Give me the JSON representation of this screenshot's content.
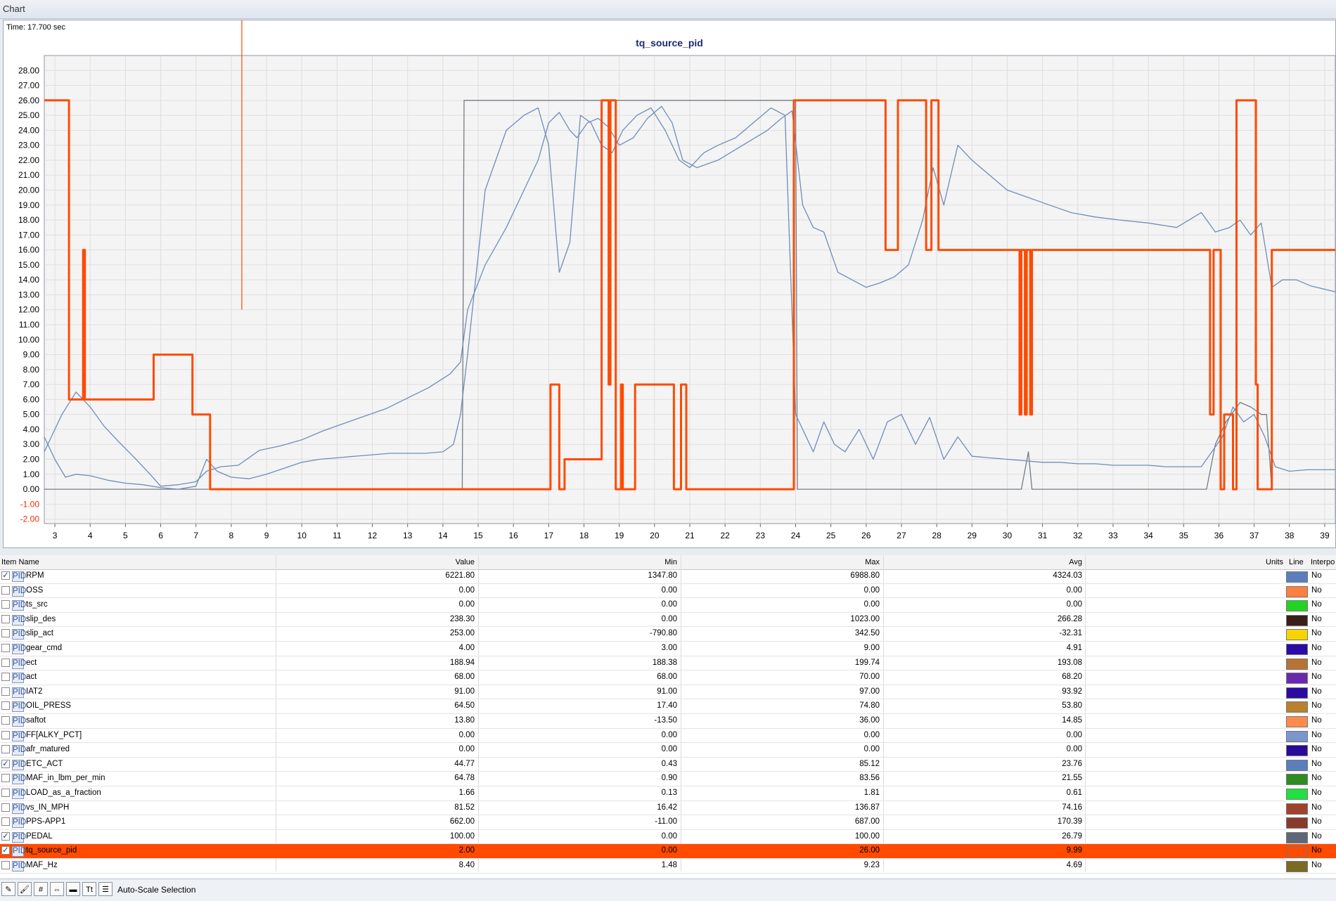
{
  "window": {
    "title": "Chart"
  },
  "chart": {
    "time_label": "Time: 17.700 sec",
    "title": "tq_source_pid"
  },
  "chart_data": {
    "type": "line",
    "title": "tq_source_pid",
    "ylim": [
      -2.3,
      29
    ],
    "xlim": [
      2.7,
      39.3
    ],
    "y_ticks": [
      "28.00",
      "27.00",
      "26.00",
      "25.00",
      "24.00",
      "23.00",
      "22.00",
      "21.00",
      "20.00",
      "19.00",
      "18.00",
      "17.00",
      "16.00",
      "15.00",
      "14.00",
      "13.00",
      "12.00",
      "11.00",
      "10.00",
      "9.00",
      "8.00",
      "7.00",
      "6.00",
      "5.00",
      "4.00",
      "3.00",
      "2.00",
      "1.00",
      "0.00",
      "-1.00",
      "-2.00"
    ],
    "x_ticks": [
      "3",
      "4",
      "5",
      "6",
      "7",
      "8",
      "9",
      "10",
      "11",
      "12",
      "13",
      "14",
      "15",
      "16",
      "17",
      "18",
      "19",
      "20",
      "21",
      "22",
      "23",
      "24",
      "25",
      "26",
      "27",
      "28",
      "29",
      "30",
      "31",
      "32",
      "33",
      "34",
      "35",
      "36",
      "37",
      "38",
      "39"
    ],
    "cursor_x": 8.3,
    "grid": true,
    "series": [
      {
        "color": "#ff4a00",
        "width": 3,
        "x": [
          2.7,
          3.4,
          3.4,
          3.8,
          3.8,
          3.85,
          3.85,
          5.8,
          5.8,
          6.9,
          6.9,
          7.4,
          7.4,
          17.05,
          17.05,
          17.3,
          17.3,
          17.45,
          17.45,
          18.5,
          18.5,
          18.7,
          18.7,
          18.75,
          18.75,
          18.9,
          18.9,
          19.05,
          19.05,
          19.1,
          19.1,
          19.45,
          19.45,
          20.55,
          20.55,
          20.75,
          20.75,
          20.9,
          20.9,
          23.95,
          23.95,
          26.55,
          26.55,
          26.9,
          26.9,
          27.7,
          27.7,
          27.85,
          27.85,
          28.05,
          28.05,
          28.55,
          28.55,
          30.35,
          30.35,
          30.4,
          30.4,
          30.5,
          30.5,
          30.55,
          30.55,
          30.65,
          30.65,
          30.7,
          30.7,
          35.75,
          35.75,
          35.85,
          35.85,
          36.05,
          36.05,
          36.15,
          36.15,
          36.4,
          36.4,
          36.5,
          36.5,
          37.05,
          37.05,
          37.1,
          37.1,
          37.5,
          37.5,
          37.6,
          37.6,
          39.3
        ],
        "y": [
          26,
          26,
          6,
          6,
          16,
          16,
          6,
          6,
          9,
          9,
          5,
          5,
          0,
          0,
          7,
          7,
          0,
          0,
          2,
          2,
          26,
          26,
          7,
          7,
          26,
          26,
          0,
          0,
          7,
          7,
          0,
          0,
          7,
          7,
          0,
          0,
          7,
          7,
          0,
          0,
          26,
          26,
          16,
          16,
          26,
          26,
          16,
          16,
          26,
          26,
          16,
          16,
          16,
          16,
          5,
          5,
          16,
          16,
          5,
          5,
          16,
          16,
          5,
          5,
          16,
          16,
          5,
          5,
          16,
          16,
          0,
          0,
          5,
          5,
          0,
          0,
          26,
          26,
          7,
          7,
          0,
          0,
          16,
          16,
          16,
          16
        ]
      },
      {
        "color": "#6f8db9",
        "width": 1.3,
        "x": [
          2.7,
          2.9,
          3.2,
          3.6,
          4.0,
          4.4,
          4.8,
          5.3,
          5.7,
          6.0,
          6.5,
          7.0,
          7.3,
          7.7,
          8.2,
          8.8,
          9.4,
          10.0,
          10.6,
          11.2,
          11.8,
          12.4,
          13.0,
          13.6,
          14.2,
          14.5,
          14.7,
          15.2,
          15.8,
          16.3,
          16.7,
          17.0,
          17.3,
          17.6,
          17.8,
          18.1,
          18.4,
          18.7,
          19.0,
          19.4,
          19.8,
          20.2,
          20.5,
          20.8,
          21.2,
          21.8,
          22.5,
          23.2,
          23.6,
          23.9,
          24.2,
          24.5,
          24.8,
          25.2,
          25.6,
          26.0,
          26.4,
          26.8,
          27.2,
          27.6,
          27.9,
          28.2,
          28.6,
          29.0,
          29.5,
          30.0,
          30.6,
          31.2,
          31.8,
          32.5,
          33.2,
          34.0,
          34.8,
          35.5,
          35.9,
          36.3,
          36.6,
          36.9,
          37.2,
          37.5,
          37.8,
          38.2,
          38.6,
          39.3
        ],
        "y": [
          2.5,
          3.5,
          5.0,
          6.5,
          5.5,
          4.2,
          3.2,
          2.0,
          1.0,
          0.2,
          0.3,
          0.5,
          1.2,
          1.5,
          1.6,
          2.6,
          2.9,
          3.3,
          3.9,
          4.4,
          4.9,
          5.4,
          6.1,
          6.8,
          7.7,
          8.5,
          12.0,
          15.0,
          17.5,
          20.0,
          22.0,
          24.5,
          25.2,
          24.0,
          23.5,
          24.5,
          24.8,
          24.2,
          23.0,
          23.5,
          24.8,
          25.6,
          24.5,
          22.0,
          21.5,
          22.0,
          23.0,
          24.0,
          24.8,
          25.3,
          19.0,
          17.5,
          17.2,
          14.5,
          14.0,
          13.5,
          13.8,
          14.2,
          15.0,
          18.0,
          21.5,
          19.0,
          23.0,
          22.0,
          21.0,
          20.0,
          19.5,
          19.0,
          18.5,
          18.2,
          18.0,
          17.8,
          17.5,
          18.5,
          17.2,
          17.5,
          18.0,
          17.0,
          17.8,
          13.5,
          14.0,
          14.0,
          13.6,
          13.2
        ]
      },
      {
        "color": "#6f8db9",
        "width": 1.3,
        "x": [
          2.7,
          3.0,
          3.3,
          3.6,
          4.0,
          4.5,
          5.0,
          5.5,
          6.0,
          6.5,
          7.0,
          7.3,
          7.6,
          8.0,
          8.5,
          9.0,
          9.5,
          10.0,
          10.5,
          11.0,
          11.5,
          12.0,
          12.5,
          13.0,
          13.5,
          14.0,
          14.3,
          14.5,
          14.7,
          15.2,
          15.8,
          16.3,
          16.7,
          17.0,
          17.3,
          17.6,
          17.9,
          18.2,
          18.5,
          18.8,
          19.1,
          19.5,
          19.9,
          20.3,
          20.7,
          21.0,
          21.4,
          21.8,
          22.3,
          22.8,
          23.3,
          23.7,
          24.0,
          24.2,
          24.5,
          24.8,
          25.1,
          25.4,
          25.8,
          26.2,
          26.6,
          27.0,
          27.4,
          27.8,
          28.2,
          28.6,
          29.0,
          29.5,
          30.0,
          30.5,
          31.0,
          31.5,
          32.0,
          32.5,
          33.0,
          33.5,
          34.0,
          34.5,
          35.0,
          35.5,
          35.8,
          36.1,
          36.4,
          36.7,
          37.0,
          37.3,
          37.6,
          38.0,
          38.5,
          39.3
        ],
        "y": [
          3.5,
          2.0,
          0.8,
          1.0,
          0.9,
          0.6,
          0.4,
          0.3,
          0.1,
          0.0,
          0.2,
          2.0,
          1.2,
          0.8,
          0.7,
          1.0,
          1.4,
          1.8,
          2.0,
          2.1,
          2.2,
          2.3,
          2.4,
          2.4,
          2.4,
          2.5,
          3.0,
          5.0,
          9.0,
          20.0,
          24.0,
          25.0,
          25.5,
          23.0,
          14.5,
          16.5,
          25.0,
          24.5,
          23.0,
          22.5,
          24.0,
          25.0,
          25.5,
          24.0,
          22.0,
          21.5,
          22.5,
          23.0,
          23.5,
          24.5,
          25.5,
          25.0,
          5.0,
          4.0,
          2.5,
          4.5,
          3.0,
          2.5,
          4.0,
          2.0,
          4.5,
          5.0,
          3.0,
          4.8,
          2.0,
          3.5,
          2.2,
          2.1,
          2.0,
          1.9,
          1.8,
          1.8,
          1.7,
          1.7,
          1.6,
          1.6,
          1.6,
          1.5,
          1.5,
          1.5,
          2.5,
          3.5,
          5.5,
          4.5,
          5.0,
          3.5,
          1.5,
          1.2,
          1.3,
          1.3
        ]
      },
      {
        "color": "#747c86",
        "width": 1.3,
        "x": [
          2.7,
          3.2,
          3.25,
          14.55,
          14.6,
          14.75,
          24.0,
          24.05,
          30.4,
          30.6,
          30.7,
          35.65,
          35.9,
          36.2,
          36.6,
          36.9,
          37.2,
          37.35,
          37.5,
          39.3
        ],
        "y": [
          0,
          0,
          0,
          0,
          26,
          26,
          26,
          0,
          0,
          2.5,
          0,
          0,
          3,
          4.5,
          5.8,
          5.5,
          5.0,
          5.0,
          0,
          0
        ]
      }
    ]
  },
  "grid": {
    "headers": {
      "name": "Item Name",
      "value": "Value",
      "min": "Min",
      "max": "Max",
      "avg": "Avg",
      "units": "Units",
      "line": "Line",
      "interp": "Interpo"
    },
    "rows": [
      {
        "checked": "✓",
        "name": "RPM",
        "value": "6221.80",
        "min": "1347.80",
        "max": "6988.80",
        "avg": "4324.03",
        "color": "#5b7fbd",
        "interp": "No"
      },
      {
        "checked": "",
        "name": "OSS",
        "value": "0.00",
        "min": "0.00",
        "max": "0.00",
        "avg": "0.00",
        "color": "#ff7f3e",
        "interp": "No"
      },
      {
        "checked": "",
        "name": "ts_src",
        "value": "0.00",
        "min": "0.00",
        "max": "0.00",
        "avg": "0.00",
        "color": "#22d422",
        "interp": "No"
      },
      {
        "checked": "",
        "name": "slip_des",
        "value": "238.30",
        "min": "0.00",
        "max": "1023.00",
        "avg": "266.28",
        "color": "#3a1e18",
        "interp": "No"
      },
      {
        "checked": "",
        "name": "slip_act",
        "value": "253.00",
        "min": "-790.80",
        "max": "342.50",
        "avg": "-32.31",
        "color": "#f5d400",
        "interp": "No"
      },
      {
        "checked": "",
        "name": "gear_cmd",
        "value": "4.00",
        "min": "3.00",
        "max": "9.00",
        "avg": "4.91",
        "color": "#2c0aa8",
        "interp": "No"
      },
      {
        "checked": "",
        "name": "ect",
        "value": "188.94",
        "min": "188.38",
        "max": "199.74",
        "avg": "193.08",
        "color": "#b87234",
        "interp": "No"
      },
      {
        "checked": "",
        "name": "act",
        "value": "68.00",
        "min": "68.00",
        "max": "70.00",
        "avg": "68.20",
        "color": "#6a28b0",
        "interp": "No"
      },
      {
        "checked": "",
        "name": "IAT2",
        "value": "91.00",
        "min": "91.00",
        "max": "97.00",
        "avg": "93.92",
        "color": "#2a0aa0",
        "interp": "No"
      },
      {
        "checked": "",
        "name": "OIL_PRESS",
        "value": "64.50",
        "min": "17.40",
        "max": "74.80",
        "avg": "53.80",
        "color": "#b88230",
        "interp": "No"
      },
      {
        "checked": "",
        "name": "saftot",
        "value": "13.80",
        "min": "-13.50",
        "max": "36.00",
        "avg": "14.85",
        "color": "#ff8a4a",
        "interp": "No"
      },
      {
        "checked": "",
        "name": "FF[ALKY_PCT]",
        "value": "0.00",
        "min": "0.00",
        "max": "0.00",
        "avg": "0.00",
        "color": "#7a96cc",
        "interp": "No"
      },
      {
        "checked": "",
        "name": "afr_matured",
        "value": "0.00",
        "min": "0.00",
        "max": "0.00",
        "avg": "0.00",
        "color": "#2a0a98",
        "interp": "No"
      },
      {
        "checked": "✓",
        "name": "ETC_ACT",
        "value": "44.77",
        "min": "0.43",
        "max": "85.12",
        "avg": "23.76",
        "color": "#5b7fbd",
        "interp": "No"
      },
      {
        "checked": "",
        "name": "MAF_in_lbm_per_min",
        "value": "64.78",
        "min": "0.90",
        "max": "83.56",
        "avg": "21.55",
        "color": "#2e8b22",
        "interp": "No"
      },
      {
        "checked": "",
        "name": "LOAD_as_a_fraction",
        "value": "1.66",
        "min": "0.13",
        "max": "1.81",
        "avg": "0.61",
        "color": "#22e040",
        "interp": "No"
      },
      {
        "checked": "",
        "name": "vs_IN_MPH",
        "value": "81.52",
        "min": "16.42",
        "max": "136.87",
        "avg": "74.16",
        "color": "#a0422c",
        "interp": "No"
      },
      {
        "checked": "",
        "name": "PPS-APP1",
        "value": "662.00",
        "min": "-11.00",
        "max": "687.00",
        "avg": "170.39",
        "color": "#8a3a2a",
        "interp": "No"
      },
      {
        "checked": "✓",
        "name": "PEDAL",
        "value": "100.00",
        "min": "0.00",
        "max": "100.00",
        "avg": "26.79",
        "color": "#606878",
        "interp": "No"
      },
      {
        "checked": "✓",
        "name": "tq_source_pid",
        "value": "2.00",
        "min": "0.00",
        "max": "26.00",
        "avg": "9.99",
        "color": "#ff4a00",
        "interp": "No"
      },
      {
        "checked": "",
        "name": "MAF_Hz",
        "value": "8.40",
        "min": "1.48",
        "max": "9.23",
        "avg": "4.69",
        "color": "#7a6a22",
        "interp": "No"
      }
    ],
    "selected_index": 19
  },
  "toolbar": {
    "buttons": [
      {
        "icon": "pencil-icon",
        "glyph": "✎"
      },
      {
        "icon": "brush-icon",
        "glyph": "🖌"
      },
      {
        "icon": "hash-icon",
        "glyph": "#"
      },
      {
        "icon": "scale-icon",
        "glyph": "⇔"
      },
      {
        "icon": "bar-icon",
        "glyph": "▬"
      },
      {
        "icon": "text-icon",
        "glyph": "Tt"
      },
      {
        "icon": "list-icon",
        "glyph": "☰"
      }
    ],
    "autoscale_label": "Auto-Scale Selection"
  }
}
